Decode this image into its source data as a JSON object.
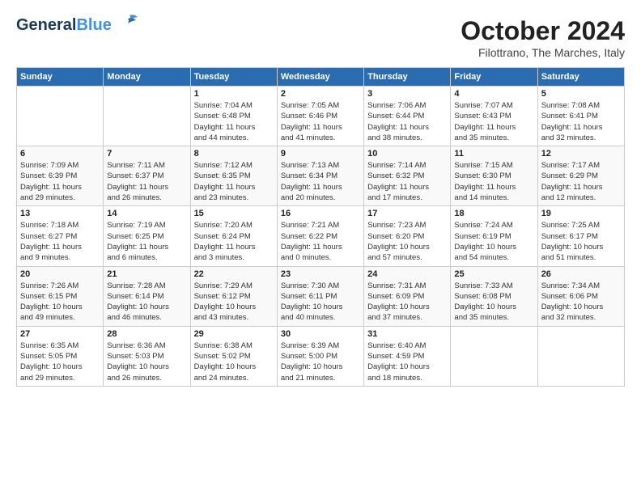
{
  "header": {
    "logo_general": "General",
    "logo_blue": "Blue",
    "title": "October 2024",
    "location": "Filottrano, The Marches, Italy"
  },
  "weekdays": [
    "Sunday",
    "Monday",
    "Tuesday",
    "Wednesday",
    "Thursday",
    "Friday",
    "Saturday"
  ],
  "weeks": [
    [
      {
        "num": "",
        "info": ""
      },
      {
        "num": "",
        "info": ""
      },
      {
        "num": "1",
        "info": "Sunrise: 7:04 AM\nSunset: 6:48 PM\nDaylight: 11 hours\nand 44 minutes."
      },
      {
        "num": "2",
        "info": "Sunrise: 7:05 AM\nSunset: 6:46 PM\nDaylight: 11 hours\nand 41 minutes."
      },
      {
        "num": "3",
        "info": "Sunrise: 7:06 AM\nSunset: 6:44 PM\nDaylight: 11 hours\nand 38 minutes."
      },
      {
        "num": "4",
        "info": "Sunrise: 7:07 AM\nSunset: 6:43 PM\nDaylight: 11 hours\nand 35 minutes."
      },
      {
        "num": "5",
        "info": "Sunrise: 7:08 AM\nSunset: 6:41 PM\nDaylight: 11 hours\nand 32 minutes."
      }
    ],
    [
      {
        "num": "6",
        "info": "Sunrise: 7:09 AM\nSunset: 6:39 PM\nDaylight: 11 hours\nand 29 minutes."
      },
      {
        "num": "7",
        "info": "Sunrise: 7:11 AM\nSunset: 6:37 PM\nDaylight: 11 hours\nand 26 minutes."
      },
      {
        "num": "8",
        "info": "Sunrise: 7:12 AM\nSunset: 6:35 PM\nDaylight: 11 hours\nand 23 minutes."
      },
      {
        "num": "9",
        "info": "Sunrise: 7:13 AM\nSunset: 6:34 PM\nDaylight: 11 hours\nand 20 minutes."
      },
      {
        "num": "10",
        "info": "Sunrise: 7:14 AM\nSunset: 6:32 PM\nDaylight: 11 hours\nand 17 minutes."
      },
      {
        "num": "11",
        "info": "Sunrise: 7:15 AM\nSunset: 6:30 PM\nDaylight: 11 hours\nand 14 minutes."
      },
      {
        "num": "12",
        "info": "Sunrise: 7:17 AM\nSunset: 6:29 PM\nDaylight: 11 hours\nand 12 minutes."
      }
    ],
    [
      {
        "num": "13",
        "info": "Sunrise: 7:18 AM\nSunset: 6:27 PM\nDaylight: 11 hours\nand 9 minutes."
      },
      {
        "num": "14",
        "info": "Sunrise: 7:19 AM\nSunset: 6:25 PM\nDaylight: 11 hours\nand 6 minutes."
      },
      {
        "num": "15",
        "info": "Sunrise: 7:20 AM\nSunset: 6:24 PM\nDaylight: 11 hours\nand 3 minutes."
      },
      {
        "num": "16",
        "info": "Sunrise: 7:21 AM\nSunset: 6:22 PM\nDaylight: 11 hours\nand 0 minutes."
      },
      {
        "num": "17",
        "info": "Sunrise: 7:23 AM\nSunset: 6:20 PM\nDaylight: 10 hours\nand 57 minutes."
      },
      {
        "num": "18",
        "info": "Sunrise: 7:24 AM\nSunset: 6:19 PM\nDaylight: 10 hours\nand 54 minutes."
      },
      {
        "num": "19",
        "info": "Sunrise: 7:25 AM\nSunset: 6:17 PM\nDaylight: 10 hours\nand 51 minutes."
      }
    ],
    [
      {
        "num": "20",
        "info": "Sunrise: 7:26 AM\nSunset: 6:15 PM\nDaylight: 10 hours\nand 49 minutes."
      },
      {
        "num": "21",
        "info": "Sunrise: 7:28 AM\nSunset: 6:14 PM\nDaylight: 10 hours\nand 46 minutes."
      },
      {
        "num": "22",
        "info": "Sunrise: 7:29 AM\nSunset: 6:12 PM\nDaylight: 10 hours\nand 43 minutes."
      },
      {
        "num": "23",
        "info": "Sunrise: 7:30 AM\nSunset: 6:11 PM\nDaylight: 10 hours\nand 40 minutes."
      },
      {
        "num": "24",
        "info": "Sunrise: 7:31 AM\nSunset: 6:09 PM\nDaylight: 10 hours\nand 37 minutes."
      },
      {
        "num": "25",
        "info": "Sunrise: 7:33 AM\nSunset: 6:08 PM\nDaylight: 10 hours\nand 35 minutes."
      },
      {
        "num": "26",
        "info": "Sunrise: 7:34 AM\nSunset: 6:06 PM\nDaylight: 10 hours\nand 32 minutes."
      }
    ],
    [
      {
        "num": "27",
        "info": "Sunrise: 6:35 AM\nSunset: 5:05 PM\nDaylight: 10 hours\nand 29 minutes."
      },
      {
        "num": "28",
        "info": "Sunrise: 6:36 AM\nSunset: 5:03 PM\nDaylight: 10 hours\nand 26 minutes."
      },
      {
        "num": "29",
        "info": "Sunrise: 6:38 AM\nSunset: 5:02 PM\nDaylight: 10 hours\nand 24 minutes."
      },
      {
        "num": "30",
        "info": "Sunrise: 6:39 AM\nSunset: 5:00 PM\nDaylight: 10 hours\nand 21 minutes."
      },
      {
        "num": "31",
        "info": "Sunrise: 6:40 AM\nSunset: 4:59 PM\nDaylight: 10 hours\nand 18 minutes."
      },
      {
        "num": "",
        "info": ""
      },
      {
        "num": "",
        "info": ""
      }
    ]
  ]
}
